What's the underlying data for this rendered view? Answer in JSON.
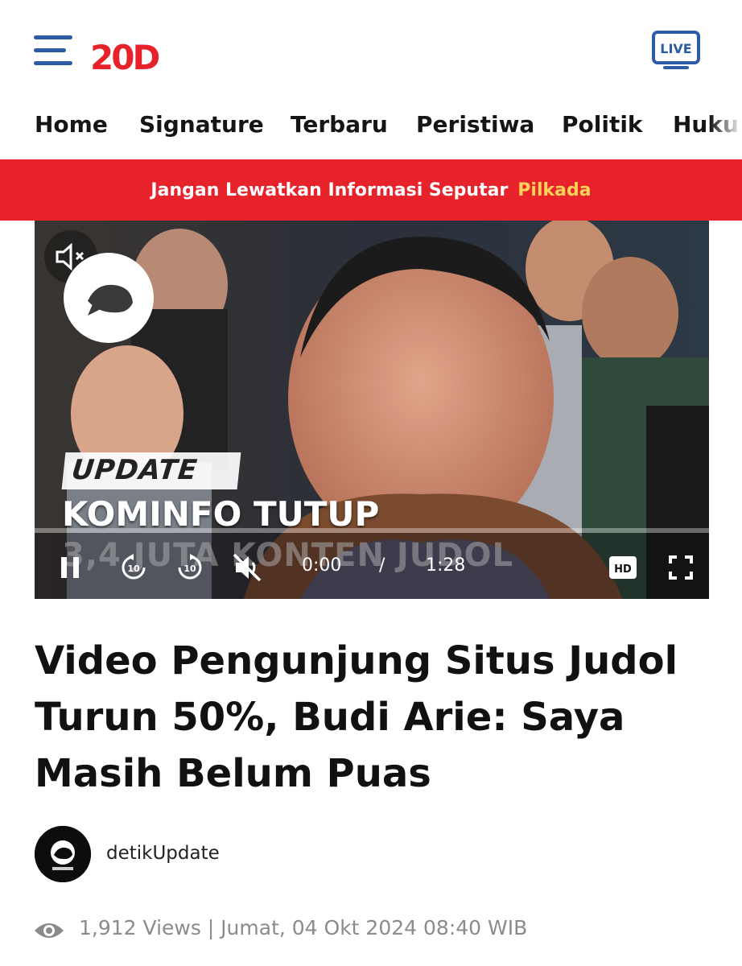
{
  "header": {
    "logo_text": "20D",
    "live_label": "LIVE"
  },
  "nav": {
    "items": [
      "Home",
      "Signature",
      "Terbaru",
      "Peristiwa",
      "Politik",
      "Huku"
    ]
  },
  "banner": {
    "text": "Jangan Lewatkan Informasi Seputar",
    "highlight": "Pilkada",
    "highlight_color": "#ffd35a",
    "background": "#e8222b"
  },
  "video": {
    "tag": "UPDATE",
    "overlay_line1": "KOMINFO TUTUP",
    "overlay_line2": "3,4 JUTA KONTEN JUDOL",
    "current_time": "0:00",
    "separator": "/",
    "duration": "1:28",
    "hd_label": "HD",
    "rewind_label": "10",
    "forward_label": "10",
    "progress": 0
  },
  "article": {
    "title": "Video Pengunjung Situs Judol Turun 50%, Budi Arie: Saya Masih Belum Puas",
    "author": "detikUpdate",
    "meta": "1,912 Views | Jumat, 04 Okt 2024 08:40 WIB"
  }
}
